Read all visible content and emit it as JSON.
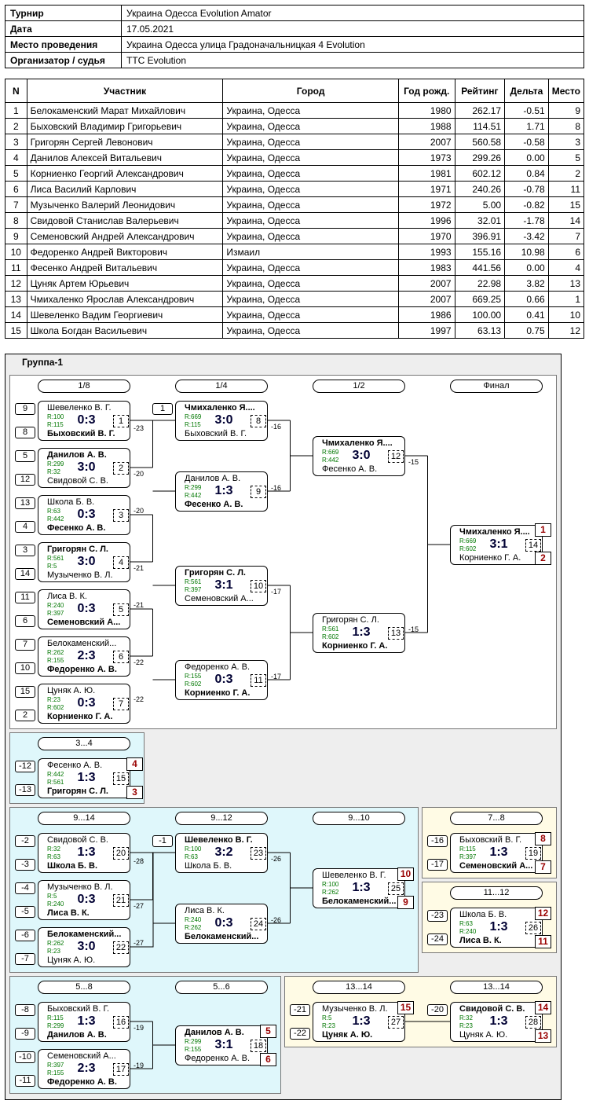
{
  "info": [
    {
      "k": "Турнир",
      "v": "Украина Одесса Evolution Amator"
    },
    {
      "k": "Дата",
      "v": "17.05.2021"
    },
    {
      "k": "Место проведения",
      "v": "Украина Одесса улица Градоначальницкая 4 Evolution"
    },
    {
      "k": "Организатор / судья",
      "v": "TTC Evolution"
    }
  ],
  "table_headers": [
    "N",
    "Участник",
    "Город",
    "Год рожд.",
    "Рейтинг",
    "Дельта",
    "Место"
  ],
  "participants": [
    [
      "1",
      "Белокаменский Марат Михайлович",
      "Украина, Одесса",
      "1980",
      "262.17",
      "-0.51",
      "9"
    ],
    [
      "2",
      "Быховский Владимир Григорьевич",
      "Украина, Одесса",
      "1988",
      "114.51",
      "1.71",
      "8"
    ],
    [
      "3",
      "Григорян Сергей Левонович",
      "Украина, Одесса",
      "2007",
      "560.58",
      "-0.58",
      "3"
    ],
    [
      "4",
      "Данилов Алексей Витальевич",
      "Украина, Одесса",
      "1973",
      "299.26",
      "0.00",
      "5"
    ],
    [
      "5",
      "Корниенко Георгий Александрович",
      "Украина, Одесса",
      "1981",
      "602.12",
      "0.84",
      "2"
    ],
    [
      "6",
      "Лиса Василий Карлович",
      "Украина, Одесса",
      "1971",
      "240.26",
      "-0.78",
      "11"
    ],
    [
      "7",
      "Музыченко Валерий Леонидович",
      "Украина, Одесса",
      "1972",
      "5.00",
      "-0.82",
      "15"
    ],
    [
      "8",
      "Свидовой Станислав Валерьевич",
      "Украина, Одесса",
      "1996",
      "32.01",
      "-1.78",
      "14"
    ],
    [
      "9",
      "Семеновский Андрей Александрович",
      "Украина, Одесса",
      "1970",
      "396.91",
      "-3.42",
      "7"
    ],
    [
      "10",
      "Федоренко Андрей Викторович",
      "Измаил",
      "1993",
      "155.16",
      "10.98",
      "6"
    ],
    [
      "11",
      "Фесенко Андрей Витальевич",
      "Украина, Одесса",
      "1983",
      "441.56",
      "0.00",
      "4"
    ],
    [
      "12",
      "Цуняк Артем Юрьевич",
      "Украина, Одесса",
      "2007",
      "22.98",
      "3.82",
      "13"
    ],
    [
      "13",
      "Чмихаленко Ярослав Александрович",
      "Украина, Одесса",
      "2007",
      "669.25",
      "0.66",
      "1"
    ],
    [
      "14",
      "Шевеленко Вадим Георгиевич",
      "Украина, Одесса",
      "1986",
      "100.00",
      "0.41",
      "10"
    ],
    [
      "15",
      "Школа Богдан Васильевич",
      "Украина, Одесса",
      "1997",
      "63.13",
      "0.75",
      "12"
    ]
  ],
  "group_title": "Группа-1",
  "stage_headers": [
    "1/8",
    "1/4",
    "1/2",
    "Финал",
    "3...4",
    "9...14",
    "9...12",
    "9...10",
    "7...8",
    "11...12",
    "5...8",
    "5...6",
    "13...14",
    "13...14"
  ],
  "matches": [
    {
      "p1": "Шевеленко В. Г.",
      "r1": "R:100",
      "r2": "R:115",
      "p2": "Быховский В. Г.",
      "win": 2,
      "score": "0:3",
      "num": "1"
    },
    {
      "p1": "Данилов А. В.",
      "r1": "R:299",
      "r2": "R:32",
      "p2": "Свидовой С. В.",
      "win": 1,
      "score": "3:0",
      "num": "2"
    },
    {
      "p1": "Школа Б. В.",
      "r1": "R:63",
      "r2": "R:442",
      "p2": "Фесенко А. В.",
      "win": 2,
      "score": "0:3",
      "num": "3"
    },
    {
      "p1": "Григорян С. Л.",
      "r1": "R:561",
      "r2": "R:5",
      "p2": "Музыченко В. Л.",
      "win": 1,
      "score": "3:0",
      "num": "4"
    },
    {
      "p1": "Лиса В. К.",
      "r1": "R:240",
      "r2": "R:397",
      "p2": "Семеновский А...",
      "win": 2,
      "score": "0:3",
      "num": "5"
    },
    {
      "p1": "Белокаменский...",
      "r1": "R:262",
      "r2": "R:155",
      "p2": "Федоренко А. В.",
      "win": 2,
      "score": "2:3",
      "num": "6"
    },
    {
      "p1": "Цуняк А. Ю.",
      "r1": "R:23",
      "r2": "R:602",
      "p2": "Корниенко Г. А.",
      "win": 2,
      "score": "0:3",
      "num": "7"
    },
    {
      "p1": "Чмихаленко Я....",
      "r1": "R:669",
      "r2": "R:115",
      "p2": "Быховский В. Г.",
      "win": 1,
      "score": "3:0",
      "num": "8"
    },
    {
      "p1": "Данилов А. В.",
      "r1": "R:299",
      "r2": "R:442",
      "p2": "Фесенко А. В.",
      "win": 2,
      "score": "1:3",
      "num": "9"
    },
    {
      "p1": "Григорян С. Л.",
      "r1": "R:561",
      "r2": "R:397",
      "p2": "Семеновский А...",
      "win": 1,
      "score": "3:1",
      "num": "10"
    },
    {
      "p1": "Федоренко А. В.",
      "r1": "R:155",
      "r2": "R:602",
      "p2": "Корниенко Г. А.",
      "win": 2,
      "score": "0:3",
      "num": "11"
    },
    {
      "p1": "Чмихаленко Я....",
      "r1": "R:669",
      "r2": "R:442",
      "p2": "Фесенко А. В.",
      "win": 1,
      "score": "3:0",
      "num": "12"
    },
    {
      "p1": "Григорян С. Л.",
      "r1": "R:561",
      "r2": "R:602",
      "p2": "Корниенко Г. А.",
      "win": 2,
      "score": "1:3",
      "num": "13"
    },
    {
      "p1": "Чмихаленко Я....",
      "r1": "R:669",
      "r2": "R:602",
      "p2": "Корниенко Г. А.",
      "win": 1,
      "score": "3:1",
      "num": "14"
    },
    {
      "p1": "Фесенко А. В.",
      "r1": "R:442",
      "r2": "R:561",
      "p2": "Григорян С. Л.",
      "win": 2,
      "score": "1:3",
      "num": "15"
    },
    {
      "p1": "Свидовой С. В.",
      "r1": "R:32",
      "r2": "R:63",
      "p2": "Школа Б. В.",
      "win": 2,
      "score": "1:3",
      "num": "20"
    },
    {
      "p1": "Музыченко В. Л.",
      "r1": "R:5",
      "r2": "R:240",
      "p2": "Лиса В. К.",
      "win": 2,
      "score": "0:3",
      "num": "21"
    },
    {
      "p1": "Белокаменский...",
      "r1": "R:262",
      "r2": "R:23",
      "p2": "Цуняк А. Ю.",
      "win": 1,
      "score": "3:0",
      "num": "22"
    },
    {
      "p1": "Шевеленко В. Г.",
      "r1": "R:100",
      "r2": "R:63",
      "p2": "Школа Б. В.",
      "win": 1,
      "score": "3:2",
      "num": "23"
    },
    {
      "p1": "Лиса В. К.",
      "r1": "R:240",
      "r2": "R:262",
      "p2": "Белокаменский...",
      "win": 2,
      "score": "0:3",
      "num": "24"
    },
    {
      "p1": "Шевеленко В. Г.",
      "r1": "R:100",
      "r2": "R:262",
      "p2": "Белокаменский...",
      "win": 2,
      "score": "1:3",
      "num": "25"
    },
    {
      "p1": "Быховский В. Г.",
      "r1": "R:115",
      "r2": "R:397",
      "p2": "Семеновский А...",
      "win": 2,
      "score": "1:3",
      "num": "19"
    },
    {
      "p1": "Школа Б. В.",
      "r1": "R:63",
      "r2": "R:240",
      "p2": "Лиса В. К.",
      "win": 2,
      "score": "1:3",
      "num": "26"
    },
    {
      "p1": "Быховский В. Г.",
      "r1": "R:115",
      "r2": "R:299",
      "p2": "Данилов А. В.",
      "win": 2,
      "score": "1:3",
      "num": "16"
    },
    {
      "p1": "Семеновский А...",
      "r1": "R:397",
      "r2": "R:155",
      "p2": "Федоренко А. В.",
      "win": 2,
      "score": "2:3",
      "num": "17"
    },
    {
      "p1": "Данилов А. В.",
      "r1": "R:299",
      "r2": "R:155",
      "p2": "Федоренко А. В.",
      "win": 1,
      "score": "3:1",
      "num": "18"
    },
    {
      "p1": "Музыченко В. Л.",
      "r1": "R:5",
      "r2": "R:23",
      "p2": "Цуняк А. Ю.",
      "win": 2,
      "score": "1:3",
      "num": "27"
    },
    {
      "p1": "Свидовой С. В.",
      "r1": "R:32",
      "r2": "R:23",
      "p2": "Цуняк А. Ю.",
      "win": 1,
      "score": "1:3",
      "num": "28"
    }
  ],
  "seeds": [
    "9",
    "8",
    "5",
    "12",
    "13",
    "4",
    "3",
    "14",
    "11",
    "6",
    "7",
    "10",
    "15",
    "2",
    "1",
    "-12",
    "-13",
    "-2",
    "-3",
    "-4",
    "-5",
    "-6",
    "-7",
    "-1",
    "-16",
    "-17",
    "-23",
    "-24",
    "-8",
    "-9",
    "-10",
    "-11",
    "-21",
    "-22",
    "-20"
  ],
  "loser_labels": [
    "-23",
    "-20",
    "-20",
    "-21",
    "-21",
    "-22",
    "-22",
    "-16",
    "-16",
    "-17",
    "-17",
    "-15",
    "-15",
    "-28",
    "-27",
    "-27",
    "-26",
    "-26",
    "-19",
    "-19"
  ],
  "places": [
    "1",
    "2",
    "4",
    "3",
    "10",
    "9",
    "8",
    "7",
    "12",
    "11",
    "5",
    "6",
    "15",
    "14",
    "13"
  ]
}
